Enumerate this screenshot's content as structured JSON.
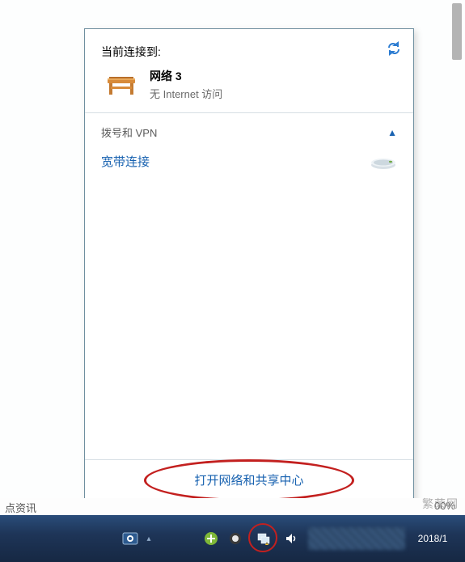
{
  "flyout": {
    "header_title": "当前连接到:",
    "network": {
      "name": "网络  3",
      "status": "无 Internet 访问"
    },
    "section_label": "拨号和 VPN",
    "connection_label": "宽带连接",
    "footer_link": "打开网络和共享中心"
  },
  "strip": {
    "left_text": "点资讯",
    "right_text": "00%"
  },
  "taskbar": {
    "date": "2018/1"
  },
  "watermark": "繁荣网"
}
